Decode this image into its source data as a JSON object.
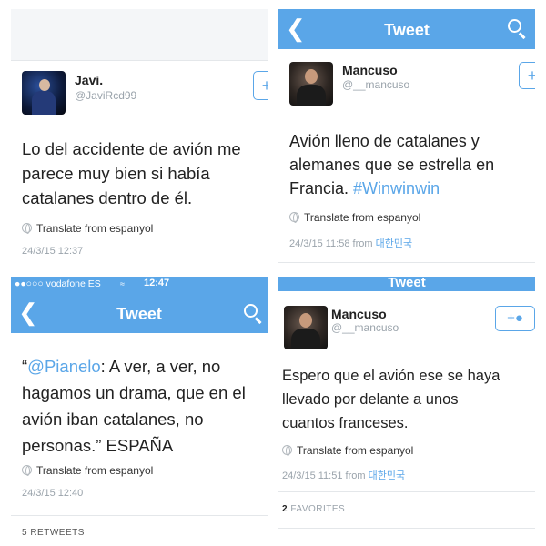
{
  "colors": {
    "accent": "#5aa6e8",
    "text": "#222222",
    "meta": "#9aa3ab"
  },
  "panel1": {
    "name": "Javi.",
    "handle": "@JaviRcd99",
    "tweet_lines": [
      "Lo del accidente de avión me",
      "parece muy bien si había",
      "catalanes dentro de él."
    ],
    "translate": "Translate from espanyol",
    "time": "24/3/15 12:37"
  },
  "panel2": {
    "nav_title": "Tweet",
    "name": "Mancuso",
    "handle": "@__mancuso",
    "tweet_lines": [
      "Avión lleno de catalanes y",
      "alemanes que se estrella en",
      "Francia."
    ],
    "hashtag": "#Winwinwin",
    "translate": "Translate from espanyol",
    "time": "24/3/15 11:58 from",
    "location": "대한민국"
  },
  "panel3": {
    "status_bar": {
      "carrier": "●●○○○ vodafone ES",
      "clock": "12:47"
    },
    "nav_title": "Tweet",
    "tweet_open_quote": "“",
    "mention": "@Pianelo",
    "tweet_lines": [
      ": A ver, a ver, no",
      "hagamos un drama, que en el",
      "avión iban catalanes, no",
      "personas.” ESPAÑA"
    ],
    "translate": "Translate from espanyol",
    "time": "24/3/15 12:40",
    "retweets_label": "5 RETWEETS"
  },
  "panel4": {
    "nav_title": "Tweet",
    "name": "Mancuso",
    "handle": "@__mancuso",
    "tweet_lines": [
      "Espero que el avión ese se haya",
      "llevado por delante a unos",
      "cuantos franceses."
    ],
    "translate": "Translate from espanyol",
    "time": "24/3/15 11:51 from",
    "location": "대한민국",
    "favorites_count": "2",
    "favorites_label": "FAVORITES"
  }
}
